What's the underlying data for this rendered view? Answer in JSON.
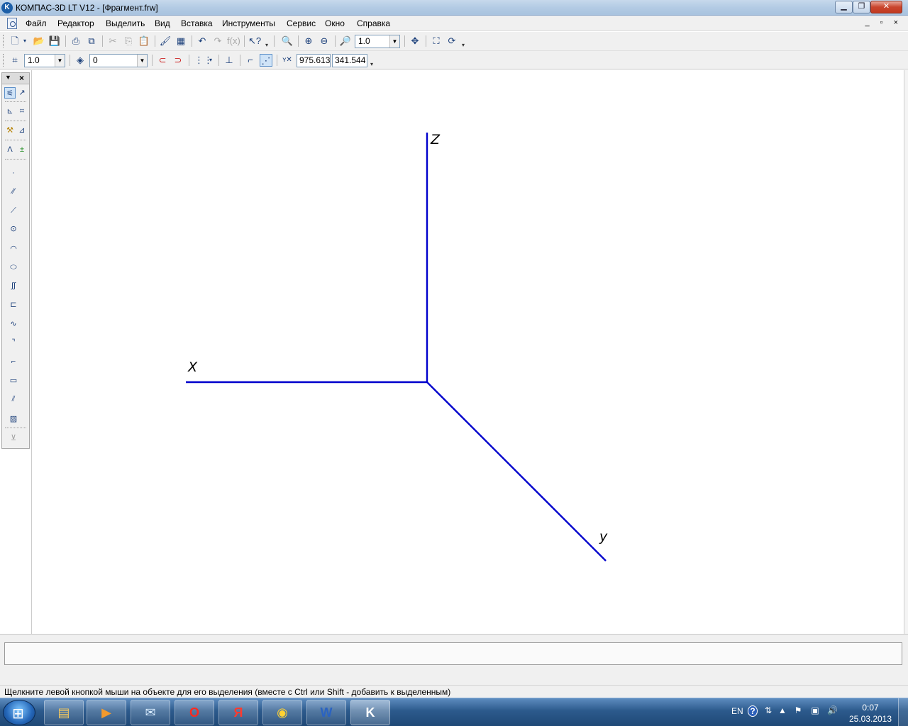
{
  "window": {
    "title": "КОМПАС-3D LT V12 - [Фрагмент.frw]",
    "app_icon": "kompas-icon",
    "minimize_icon": "minimize-icon",
    "maximize_icon": "maximize-icon",
    "close_icon": "close-icon"
  },
  "menu": {
    "items": [
      "Файл",
      "Редактор",
      "Выделить",
      "Вид",
      "Вставка",
      "Инструменты",
      "Сервис",
      "Окно",
      "Справка"
    ],
    "mdi_controls": "_ ▫ ×"
  },
  "toolbar_standard": {
    "zoom_value": "1.0"
  },
  "toolbar_current_state": {
    "grid_step": "1.0",
    "layer": "0",
    "coord_x": "975.613",
    "coord_y": "341.544"
  },
  "drawing": {
    "axis_color": "#0000cc",
    "labels": {
      "z": "Z",
      "x": "X",
      "y": "y"
    }
  },
  "status_bar": {
    "message": "Щелкните левой кнопкой мыши на объекте для его выделения (вместе с Ctrl или Shift - добавить к выделенным)"
  },
  "taskbar": {
    "apps": [
      {
        "name": "explorer-icon",
        "glyph": "▤",
        "color": "#f2c760"
      },
      {
        "name": "media-player-icon",
        "glyph": "▶",
        "color": "#f39a2d"
      },
      {
        "name": "mail-icon",
        "glyph": "✉",
        "color": "#d8ecff"
      },
      {
        "name": "opera-icon",
        "glyph": "O",
        "color": "#ff2a1f"
      },
      {
        "name": "yandex-browser-icon",
        "glyph": "Я",
        "color": "#ff3b2f"
      },
      {
        "name": "chrome-icon",
        "glyph": "◉",
        "color": "#ffd233"
      },
      {
        "name": "word-icon",
        "glyph": "W",
        "color": "#2a63c2"
      },
      {
        "name": "kompas-taskbar-icon",
        "glyph": "K",
        "color": "#ffffff"
      }
    ],
    "language": "EN",
    "time": "0:07",
    "date": "25.03.2013"
  }
}
